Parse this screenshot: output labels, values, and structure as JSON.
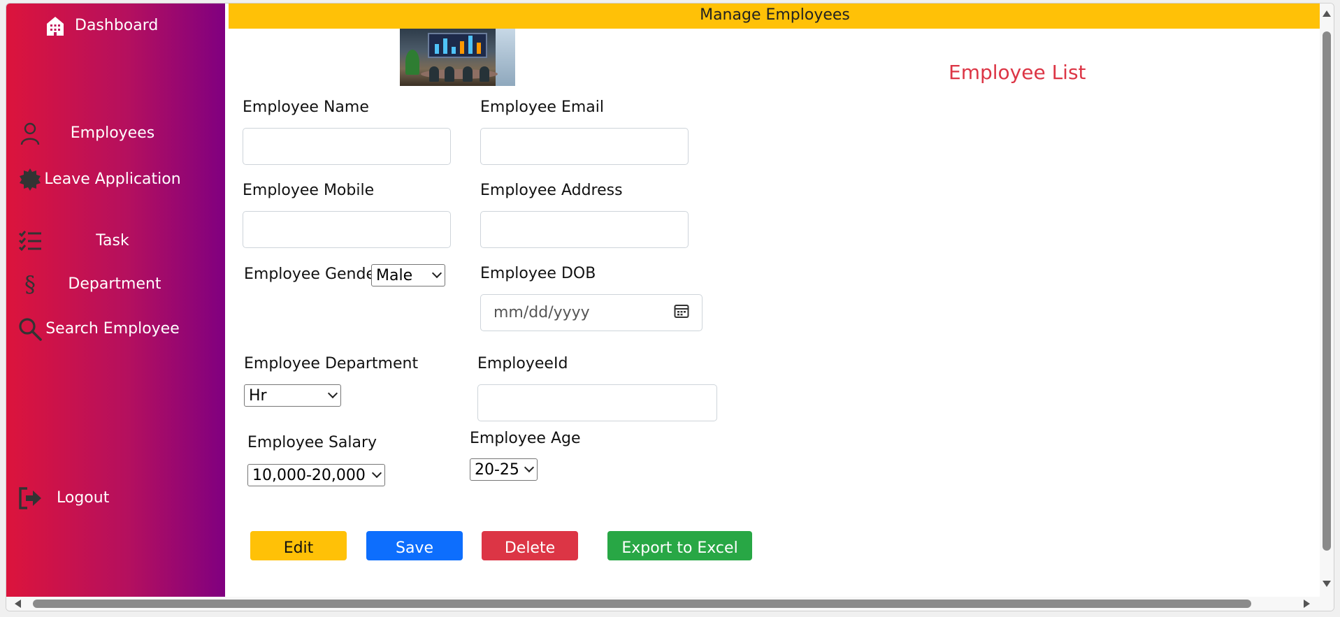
{
  "sidebar": {
    "items": [
      {
        "label": "Dashboard",
        "icon": "building-icon"
      },
      {
        "label": "Employees",
        "icon": "person-icon"
      },
      {
        "label": "Leave Application",
        "icon": "badge-icon"
      },
      {
        "label": "Task",
        "icon": "checklist-icon"
      },
      {
        "label": "Department",
        "icon": "section-icon"
      },
      {
        "label": "Search Employee",
        "icon": "search-icon"
      },
      {
        "label": "Logout",
        "icon": "logout-icon"
      }
    ],
    "section_glyph": "§"
  },
  "header": {
    "title": "Manage Employees"
  },
  "list_title": "Employee List",
  "form": {
    "name_label": "Employee Name",
    "email_label": "Employee Email",
    "mobile_label": "Employee Mobile",
    "address_label": "Employee Address",
    "gender_label": "Employee Gender",
    "gender_value": "Male",
    "dob_label": "Employee DOB",
    "dob_placeholder": "mm/dd/yyyy",
    "department_label": "Employee Department",
    "department_value": "Hr",
    "id_label": "EmployeeId",
    "salary_label": "Employee Salary",
    "salary_value": "10,000-20,000",
    "age_label": "Employee Age",
    "age_value": "20-25"
  },
  "buttons": {
    "edit": "Edit",
    "save": "Save",
    "delete": "Delete",
    "export": "Export to Excel"
  },
  "colors": {
    "header": "#ffc107",
    "list_title": "#dc3545",
    "edit": "#ffc107",
    "save": "#0d6efd",
    "delete": "#dc3545",
    "export": "#28a745",
    "sidebar_start": "#dc143c",
    "sidebar_end": "#800080"
  }
}
